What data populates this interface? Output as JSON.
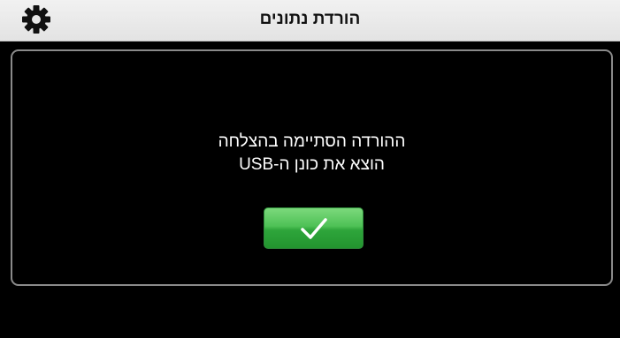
{
  "header": {
    "title": "הורדת נתונים",
    "settings_icon": "gear-icon"
  },
  "dialog": {
    "line1": "ההורדה הסתיימה בהצלחה",
    "line2": "הוצא את כונן ה-USB",
    "ok_icon": "checkmark-icon"
  },
  "colors": {
    "header_bg": "#e8e8e8",
    "dialog_border": "#8a8a8a",
    "ok_green": "#3fb54a"
  }
}
